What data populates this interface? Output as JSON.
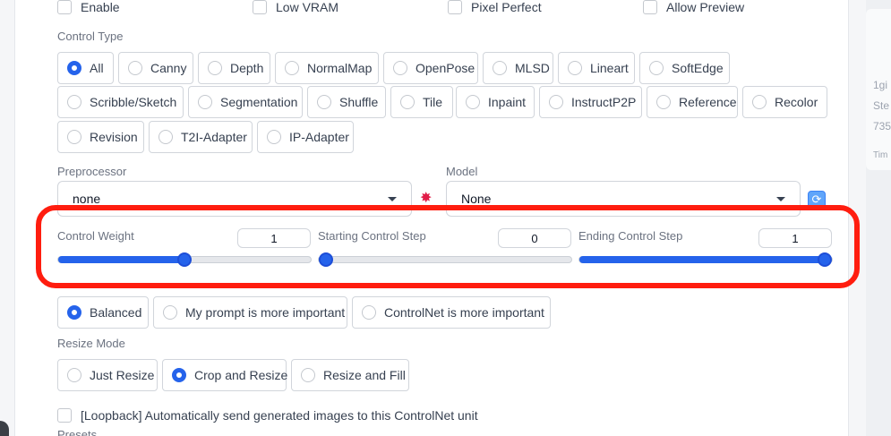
{
  "options": {
    "enable": "Enable",
    "low_vram": "Low VRAM",
    "pixel_perfect": "Pixel Perfect",
    "allow_preview": "Allow Preview"
  },
  "control_type": {
    "label": "Control Type",
    "selected": "All",
    "items": [
      "All",
      "Canny",
      "Depth",
      "NormalMap",
      "OpenPose",
      "MLSD",
      "Lineart",
      "SoftEdge",
      "Scribble/Sketch",
      "Segmentation",
      "Shuffle",
      "Tile",
      "Inpaint",
      "InstructP2P",
      "Reference",
      "Recolor",
      "Revision",
      "T2I-Adapter",
      "IP-Adapter"
    ]
  },
  "preprocessor": {
    "label": "Preprocessor",
    "value": "none"
  },
  "model": {
    "label": "Model",
    "value": "None"
  },
  "sliders": {
    "control_weight": {
      "label": "Control Weight",
      "value": "1",
      "fraction": 0.5
    },
    "starting_step": {
      "label": "Starting Control Step",
      "value": "0",
      "fraction": 0.0
    },
    "ending_step": {
      "label": "Ending Control Step",
      "value": "1",
      "fraction": 1.0
    }
  },
  "control_mode": {
    "selected": "Balanced",
    "items": [
      "Balanced",
      "My prompt is more important",
      "ControlNet is more important"
    ]
  },
  "resize_mode": {
    "label": "Resize Mode",
    "selected": "Crop and Resize",
    "items": [
      "Just Resize",
      "Crop and Resize",
      "Resize and Fill"
    ]
  },
  "loopback": {
    "label": "[Loopback] Automatically send generated images to this ControlNet unit"
  },
  "presets": {
    "label": "Presets"
  },
  "right_panel": {
    "line1": "1gi",
    "line2": "Ste",
    "line3": "735",
    "line4": "Tim"
  },
  "colors": {
    "accent": "#2563eb",
    "highlight": "#ff1d0f"
  },
  "icons": {
    "refresh_icon": "refresh-icon",
    "explosion_icon": "explosion-icon"
  }
}
